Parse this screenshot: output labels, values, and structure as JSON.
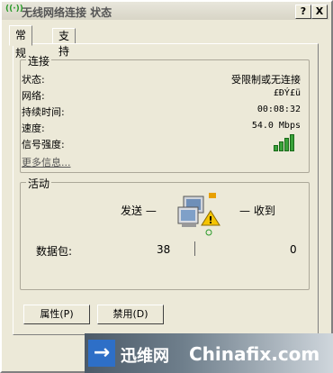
{
  "window": {
    "title": "无线网络连接 状态",
    "icon": "wireless-signal-icon",
    "help_label": "?",
    "close_label": "X"
  },
  "tabs": [
    {
      "label": "常规",
      "active": true
    },
    {
      "label": "支持",
      "active": false
    }
  ],
  "connection": {
    "group_label": "连接",
    "rows": [
      {
        "label": "状态:",
        "value": "受限制或无连接"
      },
      {
        "label": "网络:",
        "value": "£ÐÝ£ü"
      },
      {
        "label": "持续时间:",
        "value": "00:08:32"
      },
      {
        "label": "速度:",
        "value": "54.0 Mbps"
      },
      {
        "label": "信号强度:",
        "value": ""
      }
    ],
    "signal_bars": 4,
    "more_info": "更多信息..."
  },
  "activity": {
    "group_label": "活动",
    "sent_label": "发送 —",
    "received_label": "— 收到",
    "packets_label": "数据包:",
    "sent_value": "38",
    "received_value": "0"
  },
  "buttons": {
    "properties": "属性(P)",
    "disable": "禁用(D)"
  },
  "watermark": {
    "cn": "迅维网",
    "en": "Chinafix.com",
    "icon_glyph": "→"
  },
  "colors": {
    "dialog_bg": "#ece9d8",
    "signal_green": "#3aa23a",
    "warning_yellow": "#f5c400"
  }
}
